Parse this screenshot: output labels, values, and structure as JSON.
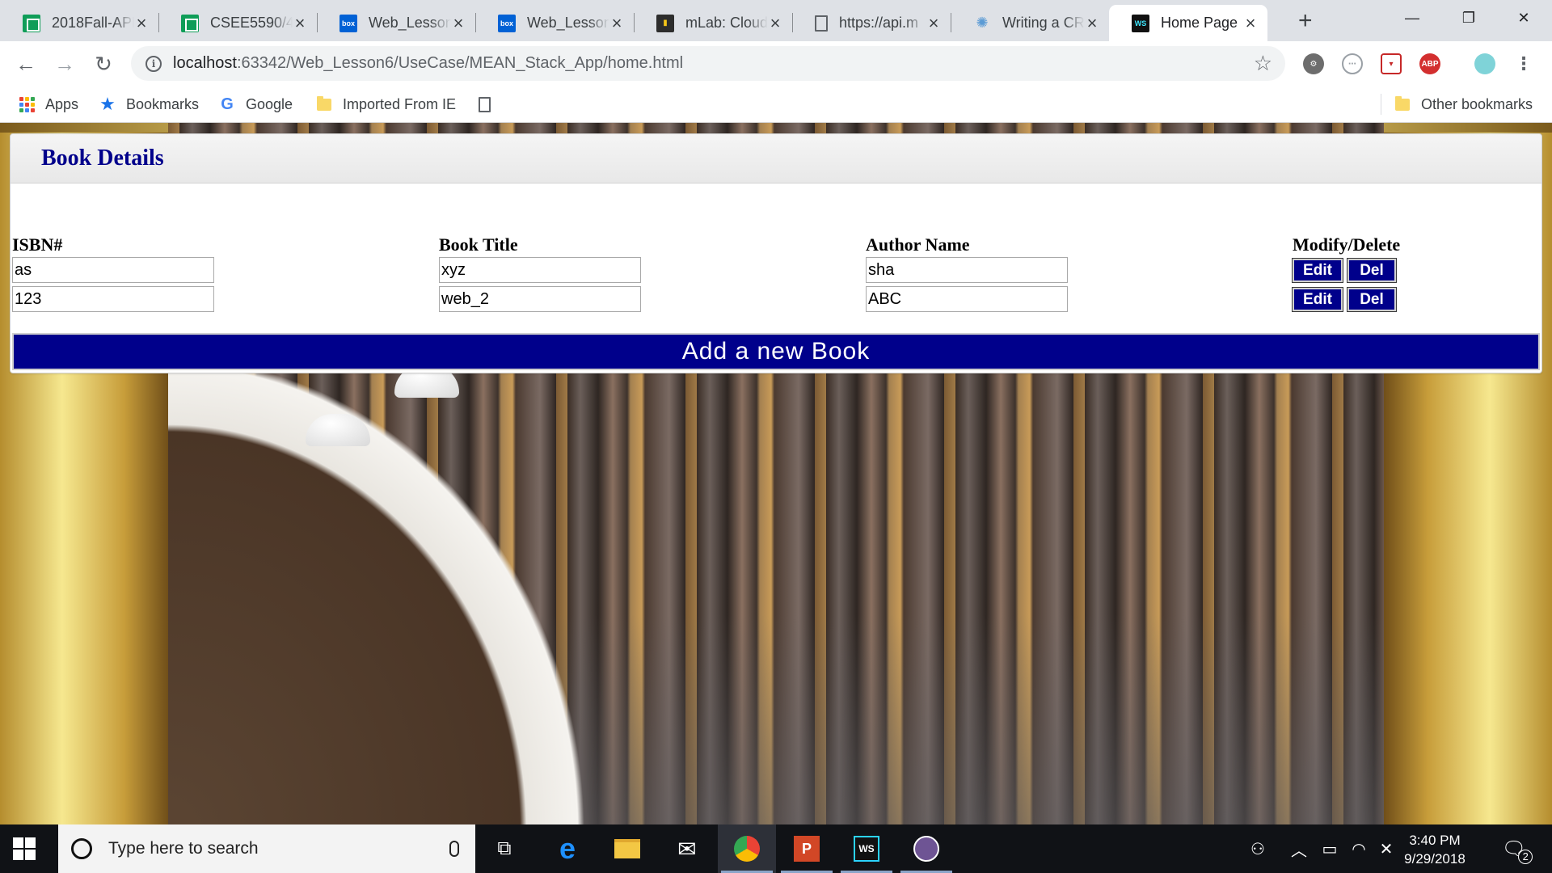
{
  "browser": {
    "tabs": [
      {
        "title": "2018Fall-APL",
        "icon": "sheets-icon"
      },
      {
        "title": "CSEE5590/49",
        "icon": "sheets-icon"
      },
      {
        "title": "Web_Lesson",
        "icon": "box-icon"
      },
      {
        "title": "Web_Lesson",
        "icon": "box-icon"
      },
      {
        "title": "mLab: Cloud",
        "icon": "mlab-icon"
      },
      {
        "title": "https://api.m",
        "icon": "document-icon"
      },
      {
        "title": "Writing a CR",
        "icon": "sun-icon"
      },
      {
        "title": "Home Page",
        "icon": "webstorm-icon",
        "active": true
      }
    ],
    "new_tab": "+",
    "window_controls": {
      "minimize": "—",
      "restore": "❐",
      "close": "✕"
    },
    "url": {
      "host": "localhost",
      "rest": ":63342/Web_Lesson6/UseCase/MEAN_Stack_App/home.html"
    },
    "bookmarks": {
      "apps": "Apps",
      "bookmarks": "Bookmarks",
      "google": "Google",
      "imported": "Imported From IE",
      "other": "Other bookmarks"
    },
    "extensions": {
      "abp": "ABP"
    }
  },
  "page": {
    "title": "Book Details",
    "columns": [
      "ISBN#",
      "Book Title",
      "Author Name",
      "Modify/Delete"
    ],
    "rows": [
      {
        "isbn": "as",
        "title": "xyz",
        "author": "sha"
      },
      {
        "isbn": "123",
        "title": "web_2",
        "author": "ABC"
      }
    ],
    "edit_label": "Edit",
    "delete_label": "Del",
    "add_button": "Add a new Book",
    "colors": {
      "primary": "#00008b",
      "heading": "#00008b"
    }
  },
  "taskbar": {
    "search_placeholder": "Type here to search",
    "time": "3:40 PM",
    "date": "9/29/2018",
    "notification_count": "2"
  }
}
